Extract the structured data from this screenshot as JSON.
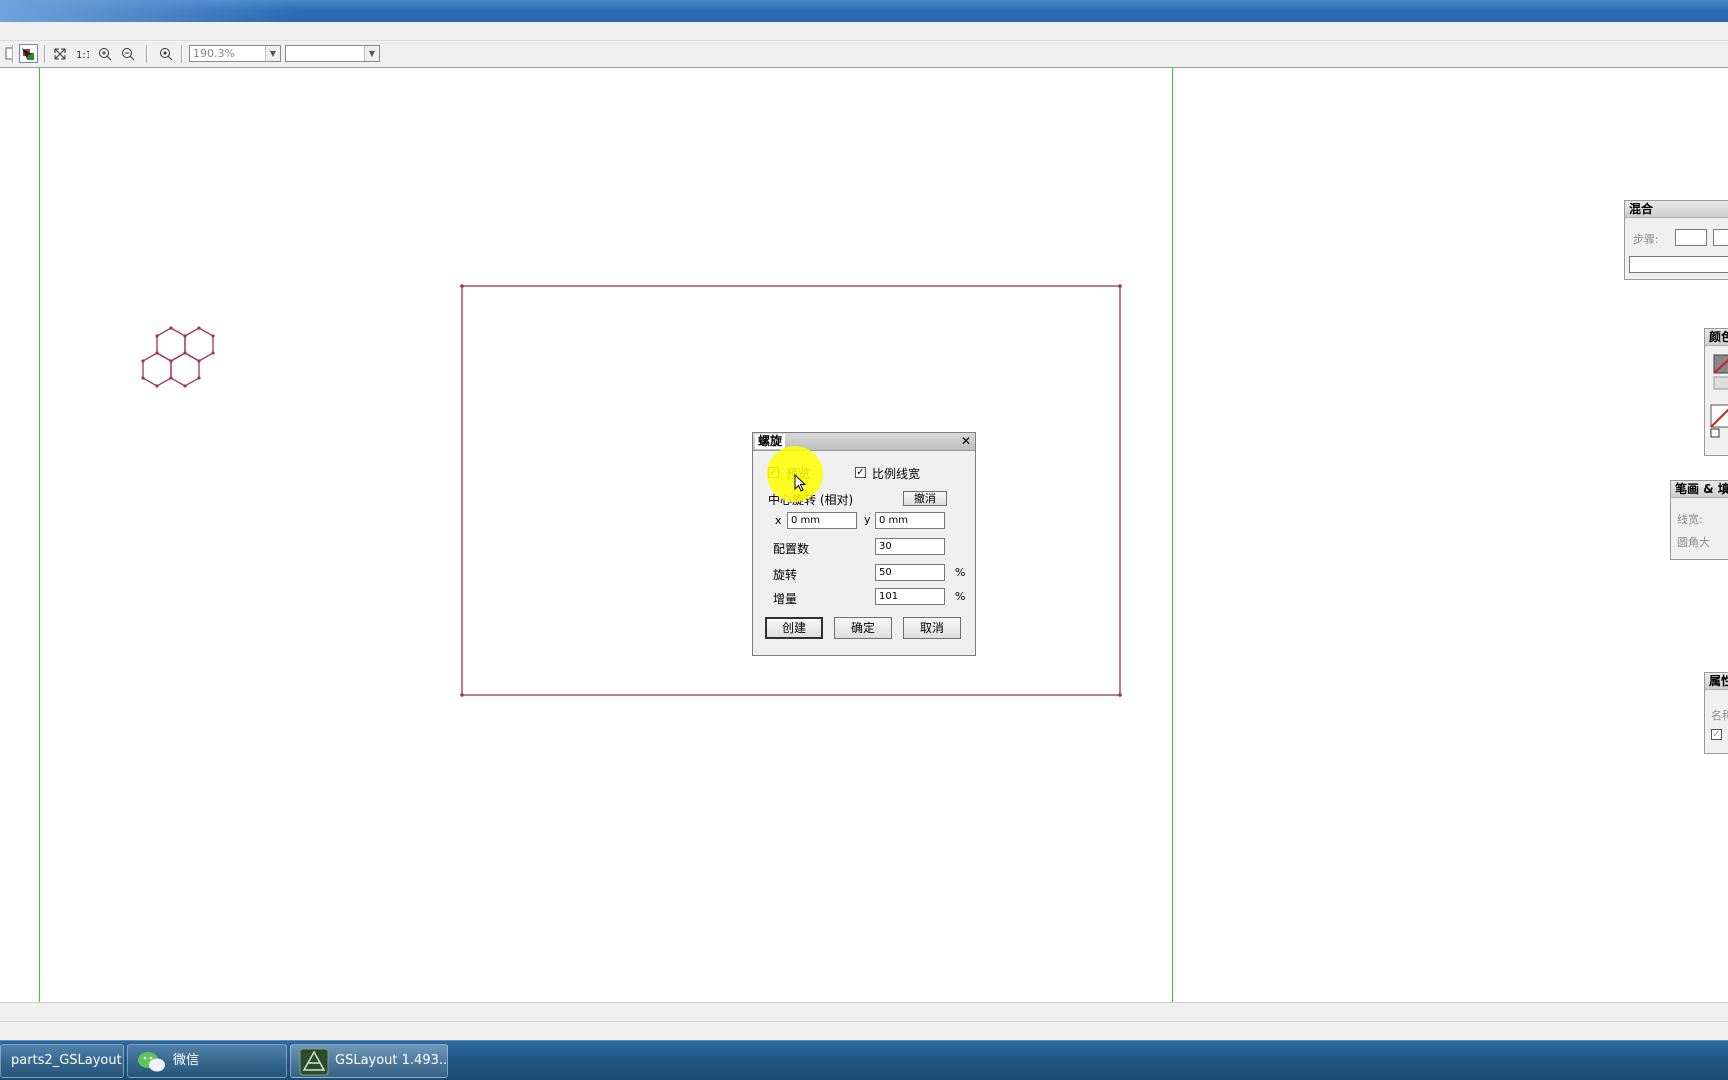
{
  "toolbar": {
    "zoom_value": "190.3%",
    "second_combo_value": ""
  },
  "panels": {
    "blend": {
      "title": "混合",
      "steps_label": "步骤:"
    },
    "color": {
      "title": "颜色"
    },
    "stroke_fill": {
      "title": "笔画 & 填",
      "line_width_label": "线宽:",
      "corner_label": "圆角大"
    },
    "properties": {
      "title": "属性",
      "name_label": "名称"
    }
  },
  "dialog": {
    "title": "螺旋",
    "preview_label": "预览",
    "preview_checked": true,
    "proportional_label": "比例线宽",
    "proportional_checked": true,
    "center_rotation_label": "中心旋转 (相对)",
    "cancel_small_label": "撤消",
    "x_label": "x",
    "x_value": "0 mm",
    "y_label": "y",
    "y_value": "0 mm",
    "count_label": "配置数",
    "count_value": "30",
    "rotation_label": "旋转",
    "rotation_value": "50",
    "rotation_unit": "%",
    "increment_label": "增量",
    "increment_value": "101",
    "increment_unit": "%",
    "create_label": "创建",
    "ok_label": "确定",
    "cancel_label": "取消"
  },
  "taskbar": {
    "items": [
      {
        "label": "parts2_GSLayout"
      },
      {
        "label": "微信"
      },
      {
        "label": "GSLayout 1.493..."
      }
    ]
  },
  "colors": {
    "margin_line": "#2fd12f",
    "shape_stroke": "#a0345f",
    "highlight": "#ffff00"
  }
}
